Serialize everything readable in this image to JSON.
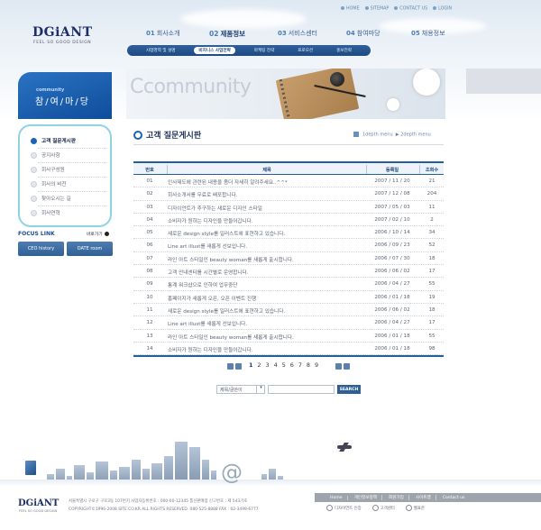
{
  "util_links": [
    "HOME",
    "SITEMAP",
    "CONTACT US",
    "LOGIN"
  ],
  "logo": {
    "name": "DGiANT",
    "tagline": "FEEL SO GOOD DESIGN"
  },
  "gnb": [
    {
      "num": "01",
      "label": "회사소개",
      "active": false
    },
    {
      "num": "02",
      "label": "제품정보",
      "active": true
    },
    {
      "num": "03",
      "label": "서비스센터",
      "active": false
    },
    {
      "num": "04",
      "label": "참여마당",
      "active": false
    },
    {
      "num": "05",
      "label": "채용정보",
      "active": false
    }
  ],
  "submenu": [
    "사업영역 및 설명",
    "비지니스 사업전략",
    "마케팅 전략",
    "프로모션",
    "홍보전략"
  ],
  "submenu_active": 1,
  "hero": {
    "title": "Ccommunity"
  },
  "community": {
    "en": "community",
    "ko": "참/여/마/당"
  },
  "lnb": [
    "고객 질문게시판",
    "공지사항",
    "회사구성원",
    "회사의 비전",
    "찾아오시는 길",
    "회사연혁"
  ],
  "focus": {
    "title": "FOCUS LINK",
    "quick": "바로가기",
    "btn1": "CEO history",
    "btn2": "DATE room"
  },
  "content": {
    "title": "고객 질문게시판",
    "crumb1": "1depth menu",
    "crumb2": "2depth menu"
  },
  "table": {
    "headers": {
      "no": "번호",
      "title": "제목",
      "date": "등록일",
      "hits": "조회수"
    },
    "rows": [
      {
        "no": "01",
        "title": "인사제도에 관련된 내용을 좀더 자세히 알려주세요..^^*",
        "date": "2007 / 11 / 20",
        "hits": "21"
      },
      {
        "no": "02",
        "title": "회사소개서를 무료로 배포합니다.",
        "date": "2007 / 12 / 08",
        "hits": "204"
      },
      {
        "no": "03",
        "title": "디자이언트가 추구하는 새로운 디자인 스타일",
        "date": "2007 / 05 / 03",
        "hits": "11"
      },
      {
        "no": "04",
        "title": "소비자가 원하는 디자인을 만들어갑니다.",
        "date": "2007 / 02 / 10",
        "hits": "2"
      },
      {
        "no": "05",
        "title": "새로운 design style를 일러스트에 표현하고 있습니다.",
        "date": "2006 / 10 / 14",
        "hits": "34"
      },
      {
        "no": "06",
        "title": "Line art illust를 새롭게 선보입니다.",
        "date": "2006 / 09 / 23",
        "hits": "52"
      },
      {
        "no": "07",
        "title": "라인 아트 스타일인 beauty woman를 새롭게 출시합니다.",
        "date": "2006 / 07 / 30",
        "hits": "18"
      },
      {
        "no": "08",
        "title": "고객 안내센터를 시간별로 운영합니다.",
        "date": "2006 / 06 / 02",
        "hits": "17"
      },
      {
        "no": "09",
        "title": "통계 워크샵으로 인하여 업무중단",
        "date": "2006 / 04 / 27",
        "hits": "55"
      },
      {
        "no": "10",
        "title": "홈페이지가 새롭게 오픈, 오픈 이벤트 진행",
        "date": "2006 / 01 / 18",
        "hits": "19"
      },
      {
        "no": "11",
        "title": "새로운 design style를 일러스트에 표현하고 있습니다.",
        "date": "2006 / 06 / 02",
        "hits": "18"
      },
      {
        "no": "12",
        "title": "Line art illust를 새롭게 선보입니다.",
        "date": "2006 / 04 / 27",
        "hits": "17"
      },
      {
        "no": "13",
        "title": "라인 아트 스타일인 beauty woman를 새롭게 출시합니다.",
        "date": "2006 / 01 / 18",
        "hits": "55"
      },
      {
        "no": "14",
        "title": "소비자가 원하는 디자인을 만들어갑니다.",
        "date": "2006 / 01 / 18",
        "hits": "98"
      }
    ]
  },
  "pagination": {
    "pages": [
      "1",
      "2",
      "3",
      "4",
      "5",
      "6",
      "7",
      "8",
      "9"
    ],
    "current": "1"
  },
  "search": {
    "select": "제목/글쓴이",
    "button": "SEARCH",
    "placeholder": ""
  },
  "footer": {
    "logo": "DGiANT",
    "tagline": "FEEL SO GOOD DESIGN",
    "address": "서울특별시 구로구 구로3동 107번지  사업자등록번호 : 000-00-12345  통신판매업 신고번호 : 제 543기호",
    "copyright": "COPYRIGHT©1996-2008 SITE.CO.KR ALL RIGHTS RESERVED.  080-525-8888  FAX : 02-3499-6777",
    "links": [
      "Home",
      "개인정보정책",
      "회원가입",
      "사이트맵",
      "Contact us"
    ],
    "marks": [
      "디자이언트 인증",
      "고객센터",
      "웹표준"
    ]
  },
  "colors": {
    "primary": "#1f4a82",
    "accent": "#235f9e",
    "lnb_border": "#8ed2e4"
  }
}
